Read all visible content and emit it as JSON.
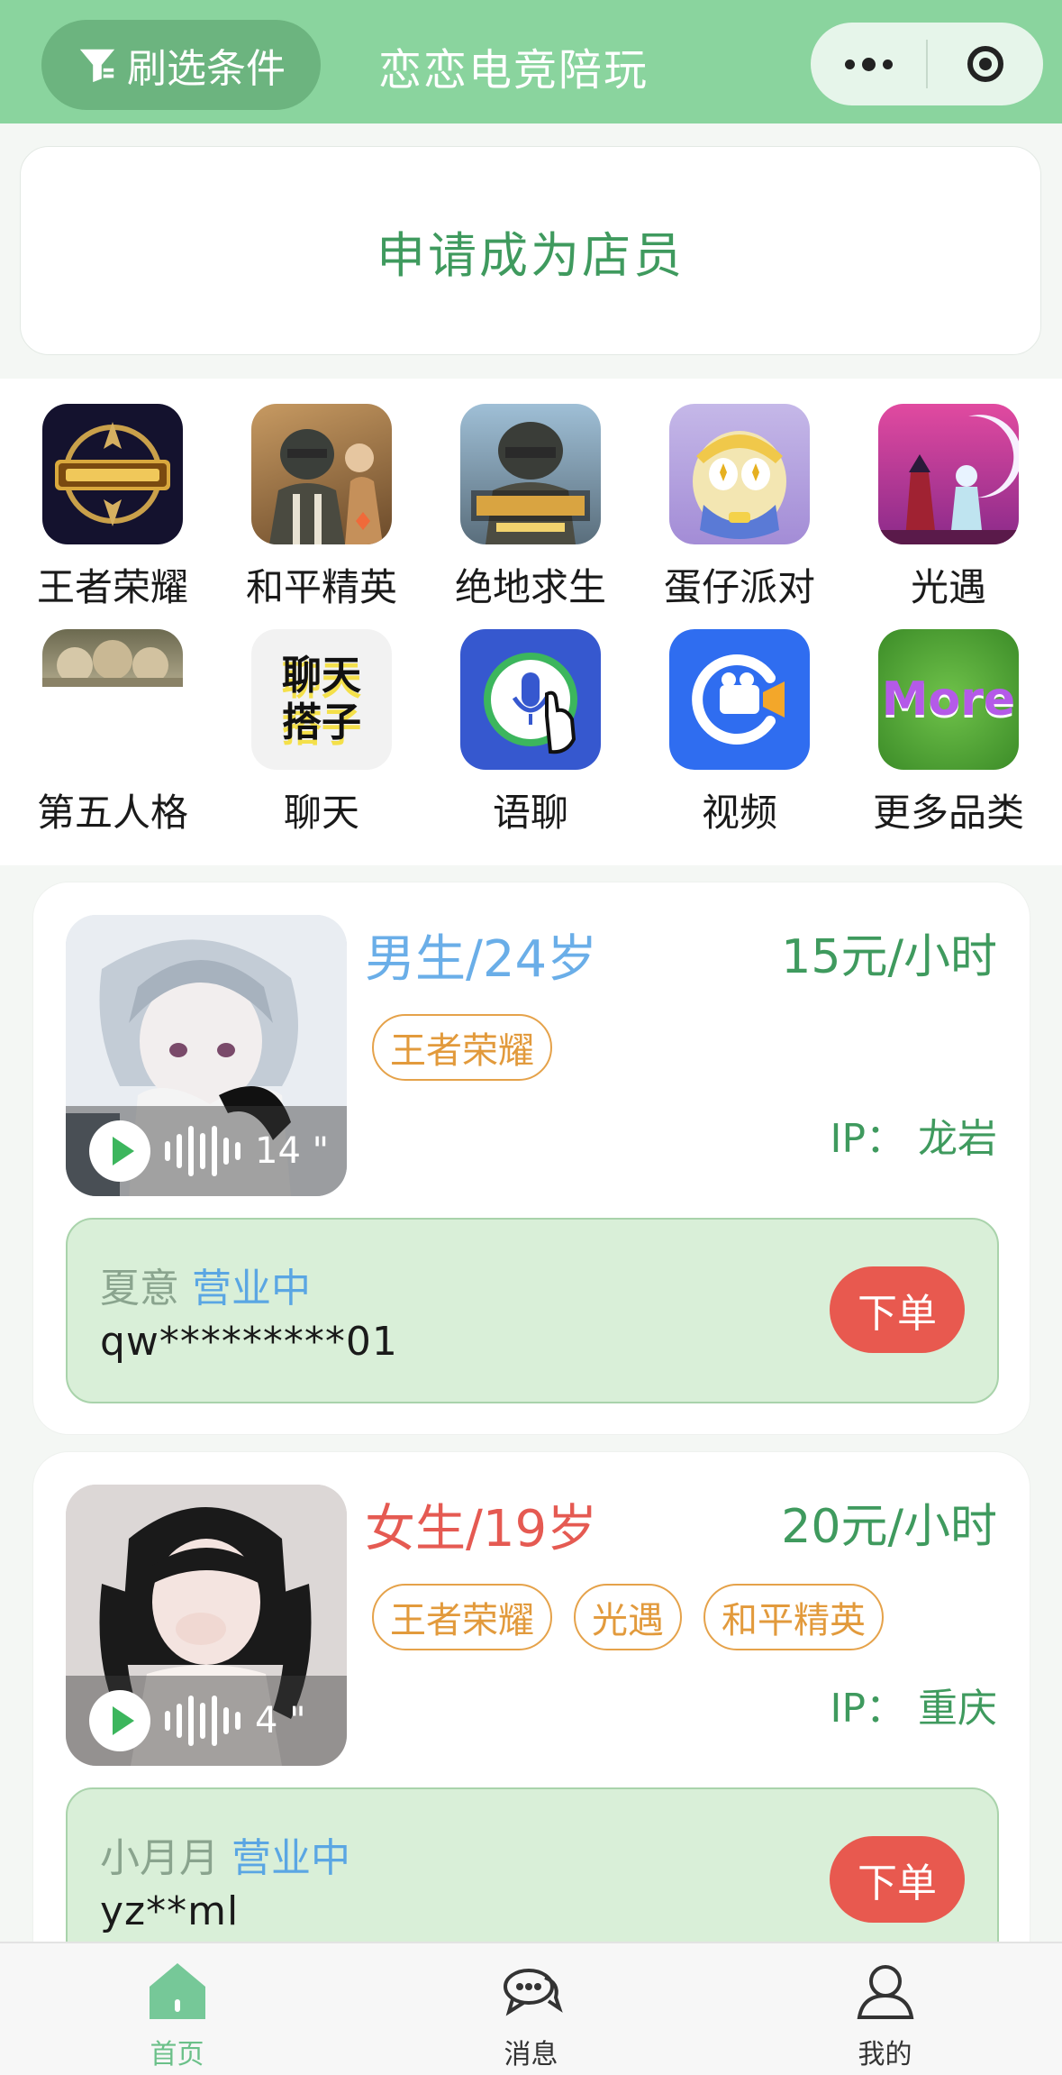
{
  "header": {
    "filter_label": "刷选条件",
    "title": "恋恋电竞陪玩"
  },
  "apply": {
    "label": "申请成为店员"
  },
  "categories": [
    {
      "label": "王者荣耀",
      "icon": "honor-of-kings-icon"
    },
    {
      "label": "和平精英",
      "icon": "peace-elite-icon"
    },
    {
      "label": "绝地求生",
      "icon": "pubg-icon"
    },
    {
      "label": "蛋仔派对",
      "icon": "eggy-party-icon"
    },
    {
      "label": "光遇",
      "icon": "sky-icon"
    },
    {
      "label": "第五人格",
      "icon": "identity-v-icon"
    },
    {
      "label": "聊天",
      "icon": "chat-buddy-icon",
      "icon_text": "聊天\n搭子"
    },
    {
      "label": "语聊",
      "icon": "voice-chat-icon"
    },
    {
      "label": "视频",
      "icon": "video-icon"
    },
    {
      "label": "更多品类",
      "icon": "more-categories-icon",
      "icon_text": "More"
    }
  ],
  "listings": [
    {
      "gender_age": "男生/24岁",
      "gender_color": "#6aaee8",
      "price": "15元/小时",
      "tags": [
        "王者荣耀"
      ],
      "ip": "IP：  龙岩",
      "voice_length": "14 \"",
      "shop_name": "夏意",
      "shop_status": "营业中",
      "shop_code": "qw*********01",
      "order_label": "下单"
    },
    {
      "gender_age": "女生/19岁",
      "gender_color": "#e55a52",
      "price": "20元/小时",
      "tags": [
        "王者荣耀",
        "光遇",
        "和平精英"
      ],
      "ip": "IP：  重庆",
      "voice_length": "4 \"",
      "shop_name": "小月月",
      "shop_status": "营业中",
      "shop_code": "yz**ml",
      "order_label": "下单"
    }
  ],
  "tabbar": {
    "home": "首页",
    "messages": "消息",
    "mine": "我的"
  },
  "colors": {
    "brand": "#8ad49e",
    "accent_green": "#3f9a5e",
    "order_red": "#e8594f"
  }
}
